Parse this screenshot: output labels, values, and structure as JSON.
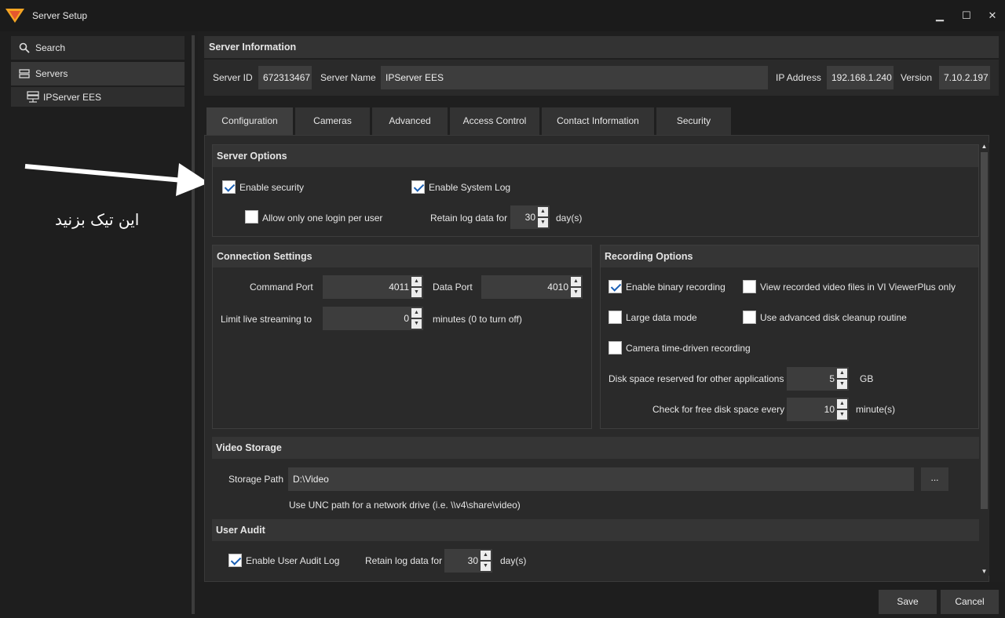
{
  "window": {
    "title": "Server Setup",
    "minimize": "🗕",
    "maximize": "☐",
    "close": "✕"
  },
  "sidebar": {
    "search_label": "Search",
    "servers_label": "Servers",
    "server_item": "IPServer EES"
  },
  "annotation": {
    "note": "این تیک بزنید"
  },
  "server_info": {
    "heading": "Server Information",
    "server_id_label": "Server ID",
    "server_id": "672313467",
    "server_name_label": "Server Name",
    "server_name": "IPServer EES",
    "ip_label": "IP Address",
    "ip": "192.168.1.240",
    "version_label": "Version",
    "version": "7.10.2.197"
  },
  "tabs": [
    "Configuration",
    "Cameras",
    "Advanced",
    "Access Control",
    "Contact Information",
    "Security"
  ],
  "server_options": {
    "heading": "Server Options",
    "enable_security": {
      "label": "Enable security",
      "checked": true
    },
    "enable_system_log": {
      "label": "Enable System Log",
      "checked": true
    },
    "one_login": {
      "label": "Allow only one login per user",
      "checked": false
    },
    "retain_label": "Retain log data for",
    "retain_value": "30",
    "retain_unit": "day(s)"
  },
  "connection": {
    "heading": "Connection Settings",
    "command_port_label": "Command Port",
    "command_port": "4011",
    "data_port_label": "Data Port",
    "data_port": "4010",
    "limit_label": "Limit live streaming to",
    "limit_value": "0",
    "limit_unit": "minutes (0 to turn off)"
  },
  "recording": {
    "heading": "Recording Options",
    "binary": {
      "label": "Enable binary recording",
      "checked": true
    },
    "viewerplus": {
      "label": "View recorded video files in VI ViewerPlus only",
      "checked": false
    },
    "large_data": {
      "label": "Large data mode",
      "checked": false
    },
    "disk_cleanup": {
      "label": "Use advanced disk cleanup routine",
      "checked": false
    },
    "time_driven": {
      "label": "Camera time-driven recording",
      "checked": false
    },
    "disk_reserved_label": "Disk space reserved for other applications",
    "disk_reserved": "5",
    "disk_reserved_unit": "GB",
    "check_free_label": "Check for free disk space every",
    "check_free": "10",
    "check_free_unit": "minute(s)"
  },
  "video_storage": {
    "heading": "Video Storage",
    "path_label": "Storage Path",
    "path": "D:\\Video",
    "browse": "...",
    "hint": "Use UNC path for a network drive (i.e. \\\\v4\\share\\video)"
  },
  "user_audit": {
    "heading": "User Audit",
    "enable": {
      "label": "Enable User Audit Log",
      "checked": true
    },
    "retain_label": "Retain log data for",
    "retain_value": "30",
    "retain_unit": "day(s)"
  },
  "footer": {
    "save": "Save",
    "cancel": "Cancel"
  },
  "colors": {
    "background": "#1f1f1f",
    "panel": "#2a2a2a",
    "header": "#353535",
    "field": "#3d3d3d",
    "logo": "#f5a623"
  }
}
